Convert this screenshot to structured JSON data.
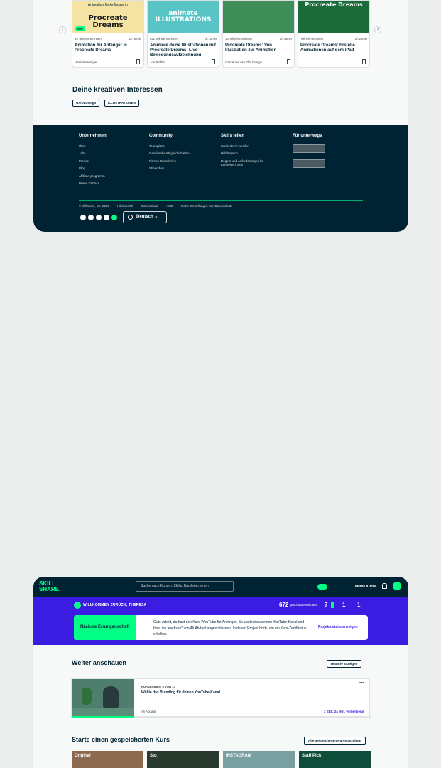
{
  "courses": [
    {
      "thumb_sub": "Animation für Anfänger in",
      "thumb_title": "Procreate Dreams",
      "badge": "Neu",
      "students": "39 Teilnehmer:innen",
      "duration": "2h 38min",
      "title": "Animation für Anfänger in Procreate Dreams",
      "author": "Harshita Kaliyar",
      "bg": "#f4e3a3"
    },
    {
      "thumb_sub": "",
      "thumb_title": "animate ILLUSTRATIONS",
      "badge": "",
      "students": "621 Teilnehmer:innen",
      "duration": "1h 10min",
      "title": "Animiere deine Illustrationen mit Procreate Dreams: Live-Bewegungsaufzeichnung",
      "author": "Joe Bichler",
      "bg": "#59c4c6"
    },
    {
      "thumb_sub": "",
      "thumb_title": "",
      "badge": "",
      "students": "10 Teilnehmer:innen",
      "duration": "1h 48min",
      "title": "Procreate Dreams: Von Illustration zur Animation",
      "author": "Cardenas van Elst Design",
      "bg": "#3f8e5a"
    },
    {
      "thumb_sub": "",
      "thumb_title": "Procreate Dreams",
      "badge": "",
      "students": "Teilnehmer:innen",
      "duration": "2h 20min",
      "title": "Procreate Dreams: Erstelle Animationen auf dem iPad",
      "author": "",
      "bg": "#1c6b3a"
    }
  ],
  "interests": {
    "title": "Deine kreativen Interessen",
    "chips": [
      "UX/UI Design",
      "ILLUSTRATIONEN"
    ]
  },
  "footer": {
    "columns": [
      {
        "heading": "Unternehmen",
        "links": [
          "Über",
          "Jobs",
          "Presse",
          "Blog",
          "Affiliate-programm",
          "Brand-Partner"
        ]
      },
      {
        "heading": "Community",
        "links": [
          "Teampläne",
          "Geschenke-Mitgliedschaften",
          "Firmen-Gutscheine",
          "Stipendien"
        ]
      },
      {
        "heading": "Skills teilen",
        "links": [
          "Kursleiter:in werden",
          "Hilfebereich",
          "Regeln und Anforderungen für Kursleiter:innen"
        ]
      },
      {
        "heading": "Für unterwegs",
        "links": []
      }
    ],
    "legal": [
      "© Skillshare, Inc. 2024",
      "Hilfebereich",
      "Datenschutz",
      "AGB",
      "Deine Einstellungen zum Datenschutz"
    ],
    "language": "Deutsch"
  },
  "header": {
    "logo_line1": "SKILL",
    "logo_line2": "SHARE.",
    "search_placeholder": "Suche nach Kursen, Skills, Kursleiter:innen",
    "my_courses": "Meine Kurse"
  },
  "banner": {
    "welcome": "WILLKOMMEN ZURÜCK, THERESA",
    "minutes": "672",
    "minutes_label": "geschaute Minuten",
    "stat1": "7",
    "stat2": "1",
    "stat3": "1"
  },
  "achievement": {
    "label": "Nächste Errungenschaft",
    "text": "Gute Arbeit, du hast den Kurs \"YouTube für Anfänger: So startest du deinen YouTube-Kanal und lässt ihn wachsen\" von Ali Abdaal abgeschlossen. Lade ein Projekt hoch, um ein Kurs-Zertifikat zu erhalten.",
    "link": "Projektdetails anzeigen"
  },
  "continue": {
    "title": "Weiter anschauen",
    "history_button": "Historie anzeigen",
    "lesson_num": "KURSEINHEIT 8 VON 14",
    "lesson_title": "Wähle das Branding für deinen YouTube-Kanal",
    "teacher": "Ali Abdaal",
    "remaining": "3 Std., 24 Min. verbleibend",
    "progress": 0.21
  },
  "saved": {
    "title": "Starte einen gespeicherten Kurs",
    "button": "Alle gespeicherten Kurse anzeigen",
    "items": [
      {
        "label": "Original",
        "bg": "#8d6a4f"
      },
      {
        "label": "Stu",
        "bg": "#2b3a2f"
      },
      {
        "label": "INSTAGRAM",
        "bg": "#7a9fa0"
      },
      {
        "label": "Staff Pick",
        "bg": "#0d4d3a"
      }
    ]
  }
}
